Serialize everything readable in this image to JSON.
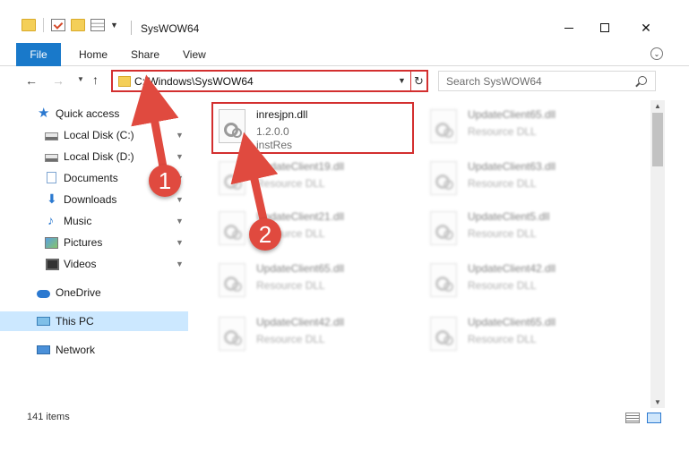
{
  "window": {
    "title": "SysWOW64",
    "controls": {
      "minimize": "–",
      "maximize": "□",
      "close": "✕"
    }
  },
  "ribbon": {
    "file_tab": "File",
    "tabs": [
      "Home",
      "Share",
      "View"
    ]
  },
  "address": {
    "path": "C:\\Windows\\SysWOW64",
    "refresh": "↻",
    "dropdown": "⌵"
  },
  "search": {
    "placeholder": "Search SysWOW64"
  },
  "nav": {
    "back": "←",
    "forward": "→",
    "up": "↑",
    "recent": "⌵"
  },
  "sidebar": {
    "items": [
      {
        "label": "Quick access",
        "icon": "star-icon",
        "pinned": false
      },
      {
        "label": "Local Disk (C:)",
        "icon": "drive-icon",
        "pinned": true
      },
      {
        "label": "Local Disk (D:)",
        "icon": "drive-icon",
        "pinned": true
      },
      {
        "label": "Documents",
        "icon": "documents-icon",
        "pinned": true
      },
      {
        "label": "Downloads",
        "icon": "download-icon",
        "pinned": true
      },
      {
        "label": "Music",
        "icon": "music-icon",
        "pinned": true
      },
      {
        "label": "Pictures",
        "icon": "pictures-icon",
        "pinned": true
      },
      {
        "label": "Videos",
        "icon": "videos-icon",
        "pinned": true
      },
      {
        "label": "OneDrive",
        "icon": "onedrive-icon",
        "pinned": false
      },
      {
        "label": "This PC",
        "icon": "this-pc-icon",
        "pinned": false,
        "selected": true
      },
      {
        "label": "Network",
        "icon": "network-icon",
        "pinned": false
      }
    ],
    "pin_glyph": "📌"
  },
  "files": {
    "highlighted": {
      "name": "inresjpn.dll",
      "version": "1.2.0.0",
      "desc": "instRes"
    },
    "left_column": [
      {
        "name": "UpdateClient19.dll",
        "desc": "Resource DLL"
      },
      {
        "name": "UpdateClient21.dll",
        "desc": "Resource DLL"
      },
      {
        "name": "UpdateClient65.dll",
        "desc": "Resource DLL"
      },
      {
        "name": "UpdateClient42.dll",
        "desc": "Resource DLL"
      }
    ],
    "right_column": [
      {
        "name": "UpdateClient65.dll",
        "desc": "Resource DLL"
      },
      {
        "name": "UpdateClient63.dll",
        "desc": "Resource DLL"
      },
      {
        "name": "UpdateClient5.dll",
        "desc": "Resource DLL"
      },
      {
        "name": "UpdateClient42.dll",
        "desc": "Resource DLL"
      },
      {
        "name": "UpdateClient65.dll",
        "desc": "Resource DLL"
      }
    ]
  },
  "status": {
    "item_count": "141 items"
  },
  "annotations": {
    "step1": "1",
    "step2": "2",
    "color": "#e04a3f"
  }
}
